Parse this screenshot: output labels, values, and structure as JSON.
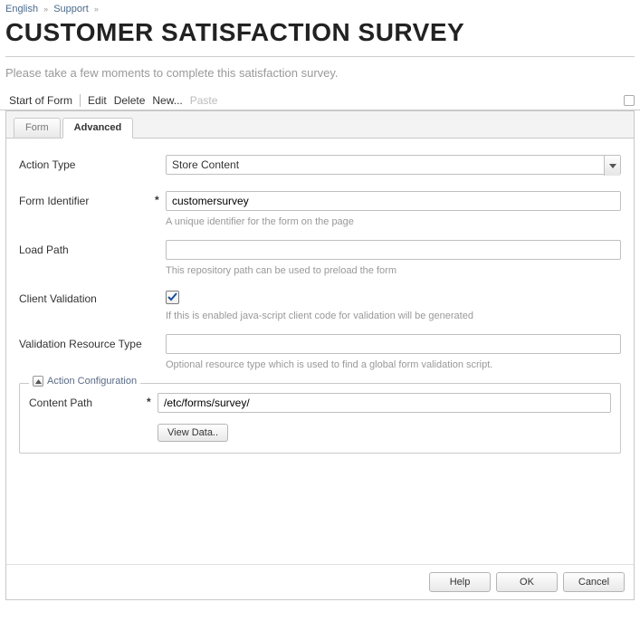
{
  "breadcrumb": {
    "items": [
      "English",
      "Support"
    ]
  },
  "pageTitle": "CUSTOMER SATISFACTION SURVEY",
  "subtitle": "Please take a few moments to complete this satisfaction survey.",
  "toolbar": {
    "items": [
      "Start of Form",
      "Edit",
      "Delete",
      "New...",
      "Paste"
    ]
  },
  "tabs": {
    "form": "Form",
    "advanced": "Advanced",
    "active": "advanced"
  },
  "form": {
    "actionType": {
      "label": "Action Type",
      "value": "Store Content"
    },
    "formIdentifier": {
      "label": "Form Identifier",
      "value": "customersurvey",
      "help": "A unique identifier for the form on the page"
    },
    "loadPath": {
      "label": "Load Path",
      "value": "",
      "help": "This repository path can be used to preload the form"
    },
    "clientValidation": {
      "label": "Client Validation",
      "checked": true,
      "help": "If this is enabled java-script client code for validation will be generated"
    },
    "validationResourceType": {
      "label": "Validation Resource Type",
      "value": "",
      "help": "Optional resource type which is used to find a global form validation script."
    },
    "actionConfig": {
      "legend": "Action Configuration",
      "contentPath": {
        "label": "Content Path",
        "value": "/etc/forms/survey/"
      },
      "viewDataBtn": "View Data.."
    }
  },
  "buttons": {
    "help": "Help",
    "ok": "OK",
    "cancel": "Cancel"
  }
}
